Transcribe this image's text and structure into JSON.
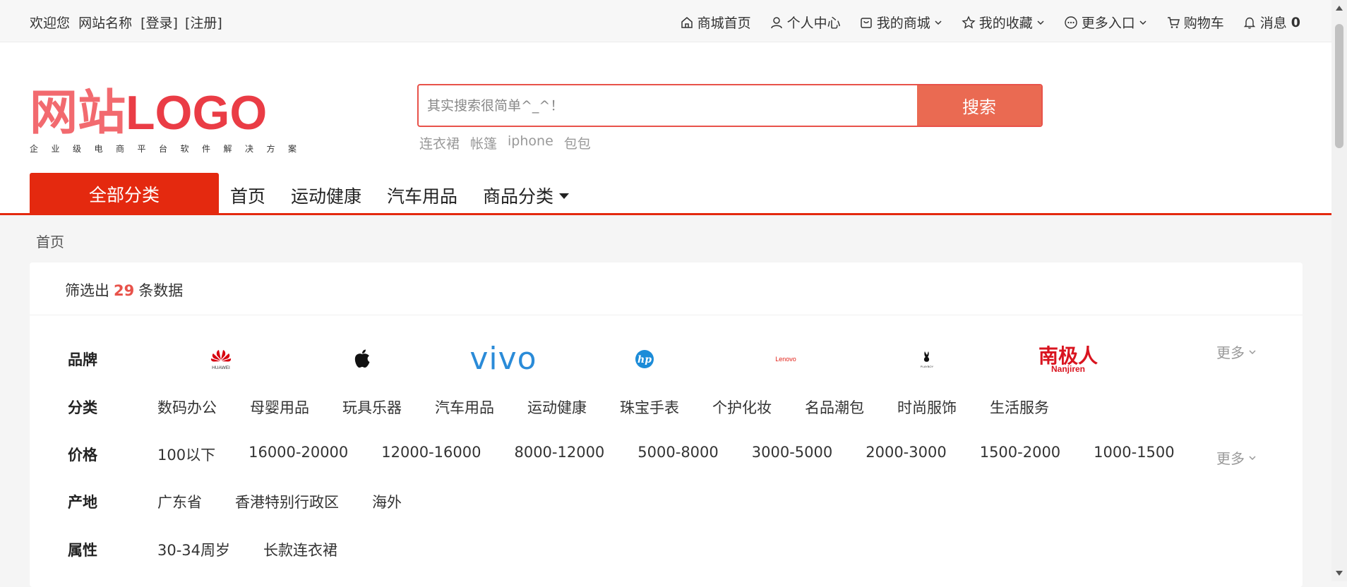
{
  "topbar": {
    "welcome": "欢迎您",
    "site_name": "网站名称",
    "login": "[登录]",
    "register": "[注册]",
    "nav": {
      "home": "商城首页",
      "user_center": "个人中心",
      "my_mall": "我的商城",
      "favorites": "我的收藏",
      "more_entries": "更多入口",
      "cart": "购物车",
      "messages": "消息",
      "message_count": "0"
    }
  },
  "header": {
    "logo_cn": "网站",
    "logo_en": "LOGO",
    "slogan": "企业级电商平台软件解决方案",
    "search_placeholder": "其实搜索很简单^_^！",
    "search_button": "搜索",
    "hot_words": [
      "连衣裙",
      "帐篷",
      "iphone",
      "包包"
    ]
  },
  "catnav": {
    "all_categories": "全部分类",
    "links": [
      "首页",
      "运动健康",
      "汽车用品"
    ],
    "dropdown_link": "商品分类"
  },
  "breadcrumb": "首页",
  "filter": {
    "count_prefix": "筛选出",
    "count": "29",
    "count_suffix": "条数据",
    "more_label": "更多",
    "brand": {
      "label": "品牌",
      "logos": [
        "huawei-logo",
        "apple-logo",
        "vivo-logo",
        "hp-logo",
        "lenovo-logo",
        "playboy-logo",
        "nanjiren-logo"
      ],
      "logo_texts": {
        "huawei": "HUAWEI",
        "vivo": "vivo",
        "hp": "hp",
        "lenovo": "Lenovo",
        "playboy": "PLAYBOY",
        "nanjiren_cn": "南极人",
        "nanjiren_en": "Nanjiren"
      }
    },
    "category": {
      "label": "分类",
      "options": [
        "数码办公",
        "母婴用品",
        "玩具乐器",
        "汽车用品",
        "运动健康",
        "珠宝手表",
        "个护化妆",
        "名品潮包",
        "时尚服饰",
        "生活服务"
      ]
    },
    "price": {
      "label": "价格",
      "options": [
        "100以下",
        "16000-20000",
        "12000-16000",
        "8000-12000",
        "5000-8000",
        "3000-5000",
        "2000-3000",
        "1500-2000",
        "1000-1500"
      ]
    },
    "origin": {
      "label": "产地",
      "options": [
        "广东省",
        "香港特别行政区",
        "海外"
      ]
    },
    "attribute": {
      "label": "属性",
      "options": [
        "30-34周岁",
        "长款连衣裙"
      ]
    }
  },
  "colors": {
    "brand_red": "#e4290f",
    "search_button": "#ea6a52",
    "count_highlight": "#e8524a"
  }
}
